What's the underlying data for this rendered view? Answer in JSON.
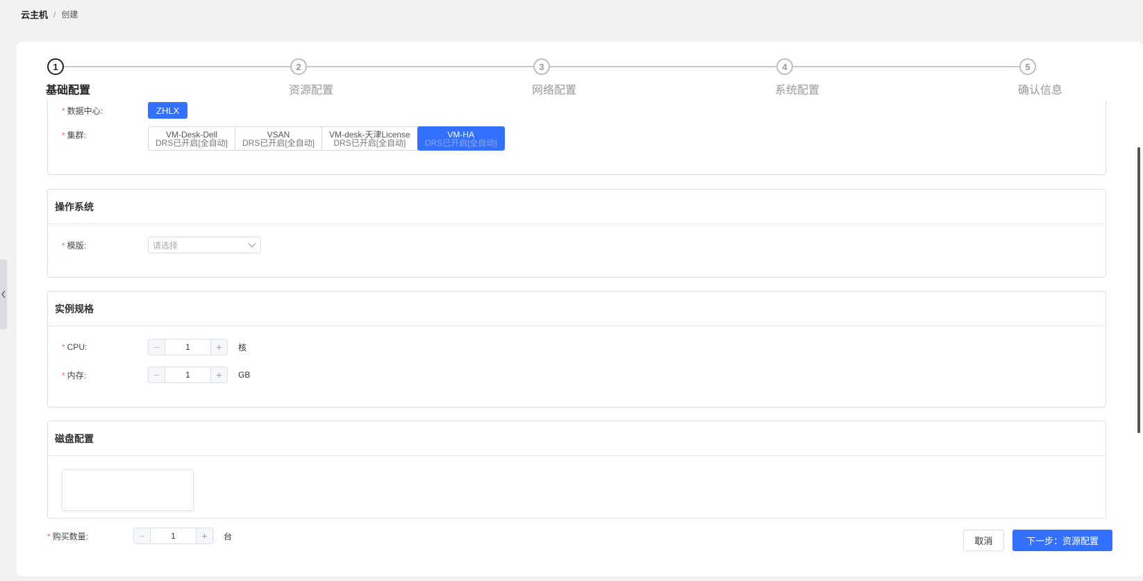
{
  "breadcrumb": {
    "root": "云主机",
    "separator": "/",
    "current": "创建"
  },
  "steps": [
    {
      "number": "1",
      "label": "基础配置",
      "active": true
    },
    {
      "number": "2",
      "label": "资源配置",
      "active": false
    },
    {
      "number": "3",
      "label": "网络配置",
      "active": false
    },
    {
      "number": "4",
      "label": "系统配置",
      "active": false
    },
    {
      "number": "5",
      "label": "确认信息",
      "active": false
    }
  ],
  "basic": {
    "datacenter_label": "数据中心:",
    "datacenter_value": "ZHLX",
    "cluster_label": "集群:",
    "clusters": [
      {
        "name": "VM-Desk-Dell",
        "status": "DRS已开启[全自动]",
        "selected": false
      },
      {
        "name": "VSAN",
        "status": "DRS已开启[全自动]",
        "selected": false
      },
      {
        "name": "VM-desk-天津License",
        "status": "DRS已开启[全自动]",
        "selected": false
      },
      {
        "name": "VM-HA",
        "status": "DRS已开启[全自动]",
        "selected": true
      }
    ]
  },
  "os": {
    "title": "操作系统",
    "template_label": "模版:",
    "template_placeholder": "请选择"
  },
  "spec": {
    "title": "实例规格",
    "cpu_label": "CPU:",
    "cpu_value": "1",
    "cpu_unit": "核",
    "memory_label": "内存:",
    "memory_value": "1",
    "memory_unit": "GB"
  },
  "disk": {
    "title": "磁盘配置"
  },
  "footer": {
    "quantity_label": "购买数量:",
    "quantity_value": "1",
    "quantity_unit": "台",
    "cancel_label": "取消",
    "next_label": "下一步：资源配置"
  },
  "common": {
    "required_mark": "*",
    "minus": "−",
    "plus": "+"
  },
  "colors": {
    "primary": "#3370ff",
    "required": "#f56c6c"
  }
}
